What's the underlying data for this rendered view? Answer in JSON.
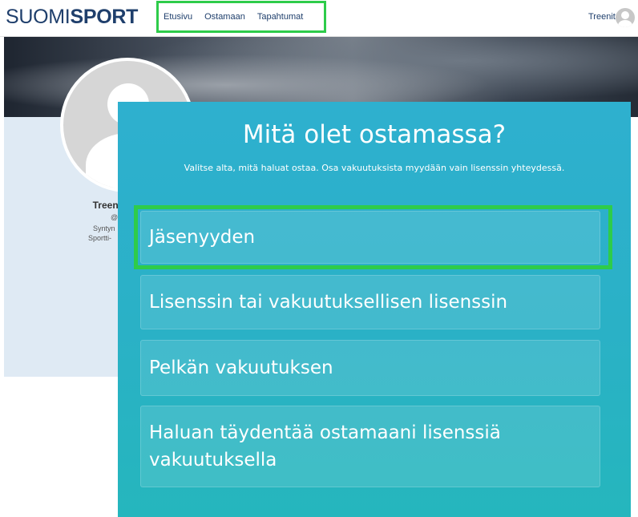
{
  "header": {
    "logo_light": "SUOMI",
    "logo_bold": "SPORT",
    "nav": [
      "Etusivu",
      "Ostamaan",
      "Tapahtumat"
    ],
    "user_label": "Treenit"
  },
  "profile": {
    "name": "Treeni",
    "handle": "@",
    "line1": "Syntyn",
    "line2": "Sportti-"
  },
  "modal": {
    "title": "Mitä olet ostamassa?",
    "subtitle": "Valitse alta, mitä haluat ostaa. Osa vakuutuksista myydään vain lisenssin yhteydessä.",
    "options": [
      "Jäsenyyden",
      "Lisenssin tai vakuutuksellisen lisenssin",
      "Pelkän vakuutuksen",
      "Haluan täydentää ostamaani lisenssiä vakuutuksella"
    ]
  },
  "colors": {
    "brand": "#1f3f6c",
    "modal_bg": "#2ab1c6",
    "highlight": "#2ecc4a"
  }
}
